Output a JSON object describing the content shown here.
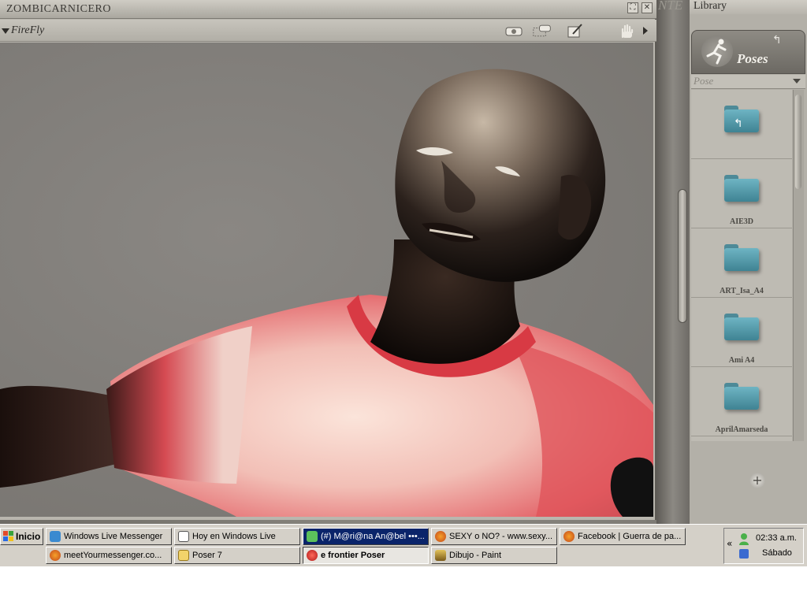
{
  "document": {
    "title": "ZOMBICARNICERO",
    "render_engine": "FireFly"
  },
  "background_text": "NTE",
  "library": {
    "title": "Library",
    "category": "Poses",
    "dropdown_label": "Pose",
    "items": [
      {
        "label": "",
        "type": "up-folder"
      },
      {
        "label": "AIE3D"
      },
      {
        "label": "ART_Isa_A4"
      },
      {
        "label": "Ami A4"
      },
      {
        "label": "AprilAmarseda"
      }
    ],
    "add_icon": "plus-circle-icon"
  },
  "taskbar": {
    "start_label": "Inicio",
    "row1": [
      {
        "label": "Windows Live Messenger",
        "icon": "messenger-icon"
      },
      {
        "label": "Hoy en Windows Live",
        "icon": "window-icon"
      },
      {
        "label": "(#) M@ri@na An@bel •••...",
        "icon": "messenger-user-icon",
        "highlight": true
      },
      {
        "label": "SEXY o NO? - www.sexy...",
        "icon": "firefox-icon"
      },
      {
        "label": "Facebook | Guerra de pa...",
        "icon": "firefox-icon"
      }
    ],
    "row2": [
      {
        "label": "meetYourmessenger.co...",
        "icon": "firefox-icon"
      },
      {
        "label": "Poser 7",
        "icon": "folder-icon"
      },
      {
        "label": "e frontier Poser",
        "icon": "poser-icon",
        "active": true
      },
      {
        "label": "Dibujo - Paint",
        "icon": "paint-icon"
      }
    ],
    "clock": "02:33 a.m.",
    "day": "Sábado"
  },
  "colors": {
    "folder": "#5fa6b6",
    "shirt_red": "#e04a52",
    "taskbar": "#d4d0c8",
    "highlight": "#0a246a"
  }
}
